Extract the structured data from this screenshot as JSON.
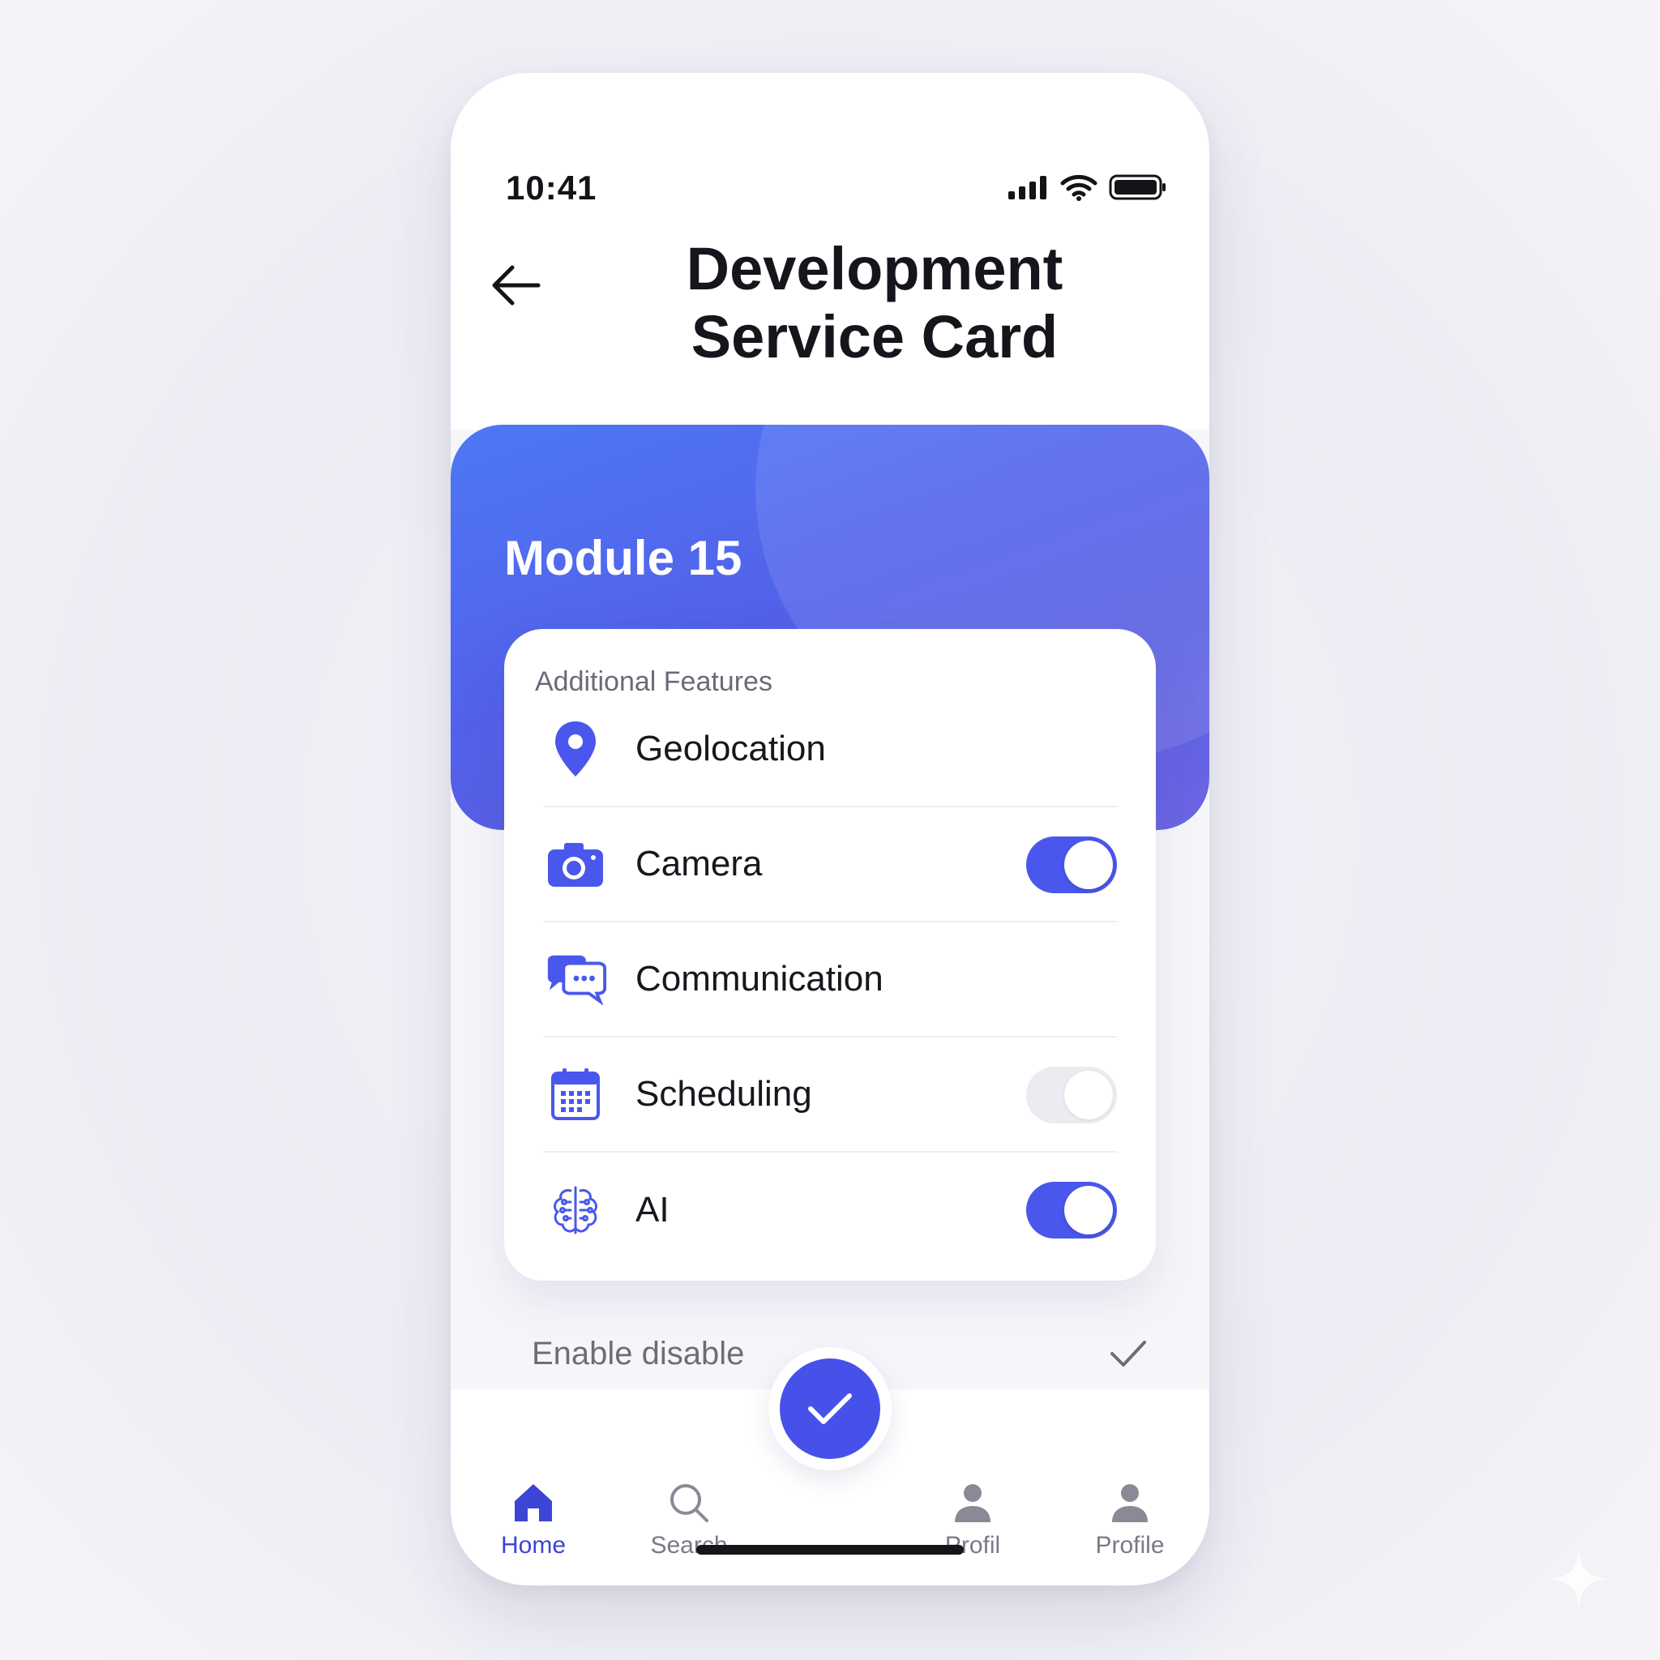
{
  "status_bar": {
    "time": "10:41"
  },
  "header": {
    "title_line1": "Development",
    "title_line2": "Service Card"
  },
  "hero": {
    "title": "Module 15"
  },
  "card": {
    "heading": "Additional Features",
    "features": [
      {
        "label": "Geolocation",
        "icon": "location-pin-icon",
        "toggle": null
      },
      {
        "label": "Camera",
        "icon": "camera-icon",
        "toggle": "on"
      },
      {
        "label": "Communication",
        "icon": "chat-bubbles-icon",
        "toggle": null
      },
      {
        "label": "Scheduling",
        "icon": "calendar-icon",
        "toggle": "off"
      },
      {
        "label": "AI",
        "icon": "brain-circuit-icon",
        "toggle": "on"
      }
    ]
  },
  "enable_row": {
    "label": "Enable disable"
  },
  "tabbar": {
    "tabs": [
      {
        "label": "Home",
        "icon": "home-icon",
        "active": true
      },
      {
        "label": "Search",
        "icon": "search-icon",
        "active": false
      },
      {
        "label": "Profil",
        "icon": "person-icon",
        "active": false
      },
      {
        "label": "Profile",
        "icon": "person-icon",
        "active": false
      }
    ]
  },
  "colors": {
    "accent": "#4a57ec",
    "active_tab": "#3c45d6",
    "text": "#17171d",
    "muted": "#6d6d78"
  }
}
